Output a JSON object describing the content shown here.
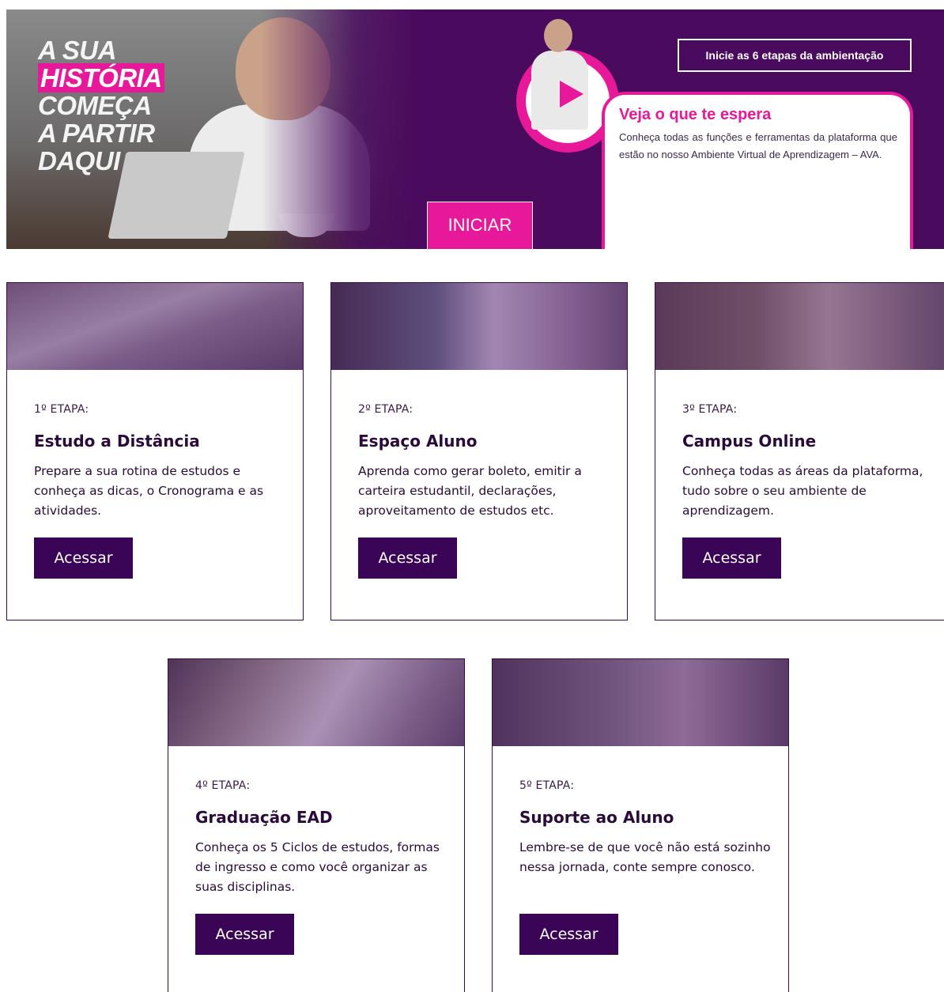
{
  "hero": {
    "slogan": [
      "A SUA",
      "HISTÓRIA",
      "COMEÇA",
      "A PARTIR",
      "DAQUI"
    ],
    "start_button": "INICIAR",
    "steps_cta": "Inicie as 6 etapas da ambientação",
    "info_title": "Veja o que te espera",
    "info_text": "Conheça todas as funções e ferramentas da plataforma que estão no nosso Ambiente Virtual de Aprendizagem – AVA.",
    "accent_color": "#e8189b",
    "background_color": "#4a0a5e"
  },
  "cards": [
    {
      "step": "1º ETAPA:",
      "title": "Estudo a Distância",
      "description": "Prepare a sua rotina de estudos e conheça as dicas, o Cronograma e as atividades.",
      "button": "Acessar"
    },
    {
      "step": "2º ETAPA:",
      "title": "Espaço Aluno",
      "description": "Aprenda como gerar boleto, emitir a carteira estudantil, declarações, aproveitamento de estudos etc.",
      "button": "Acessar"
    },
    {
      "step": "3º ETAPA:",
      "title": "Campus Online",
      "description": "Conheça todas as áreas da plataforma, tudo sobre o seu ambiente de aprendizagem.",
      "button": "Acessar"
    },
    {
      "step": "4º ETAPA:",
      "title": "Graduação EAD",
      "description": "Conheça os 5 Ciclos de estudos, formas de ingresso e como você organizar as suas disciplinas.",
      "button": "Acessar"
    },
    {
      "step": "5º ETAPA:",
      "title": "Suporte ao Aluno",
      "description": "Lembre-se de que você não está sozinho nessa jornada, conte sempre conosco.",
      "button": "Acessar"
    }
  ],
  "button_color": "#3a0556"
}
